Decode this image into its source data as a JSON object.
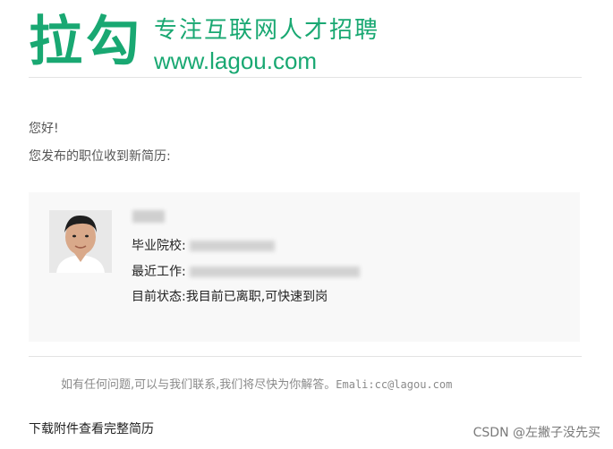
{
  "header": {
    "logo_text": "拉勾",
    "tagline": "专注互联网人才招聘",
    "domain": "www.lagou.com",
    "brand_color": "#19a872"
  },
  "email": {
    "greeting": "您好!",
    "intro": "您发布的职位收到新简历:",
    "resume": {
      "school_label": "毕业院校:",
      "recent_work_label": "最近工作:",
      "status_label": "目前状态:",
      "status_value": "我目前已离职,可快速到岗",
      "redacted_fields": [
        "name",
        "school",
        "recent_work"
      ]
    },
    "contact_text": "如有任何问题,可以与我们联系,我们将尽快为你解答。",
    "contact_email_label": "Emali:",
    "contact_email": "cc@lagou.com",
    "download_link": "下载附件查看完整简历"
  },
  "watermark": "CSDN @左撇子没先买"
}
